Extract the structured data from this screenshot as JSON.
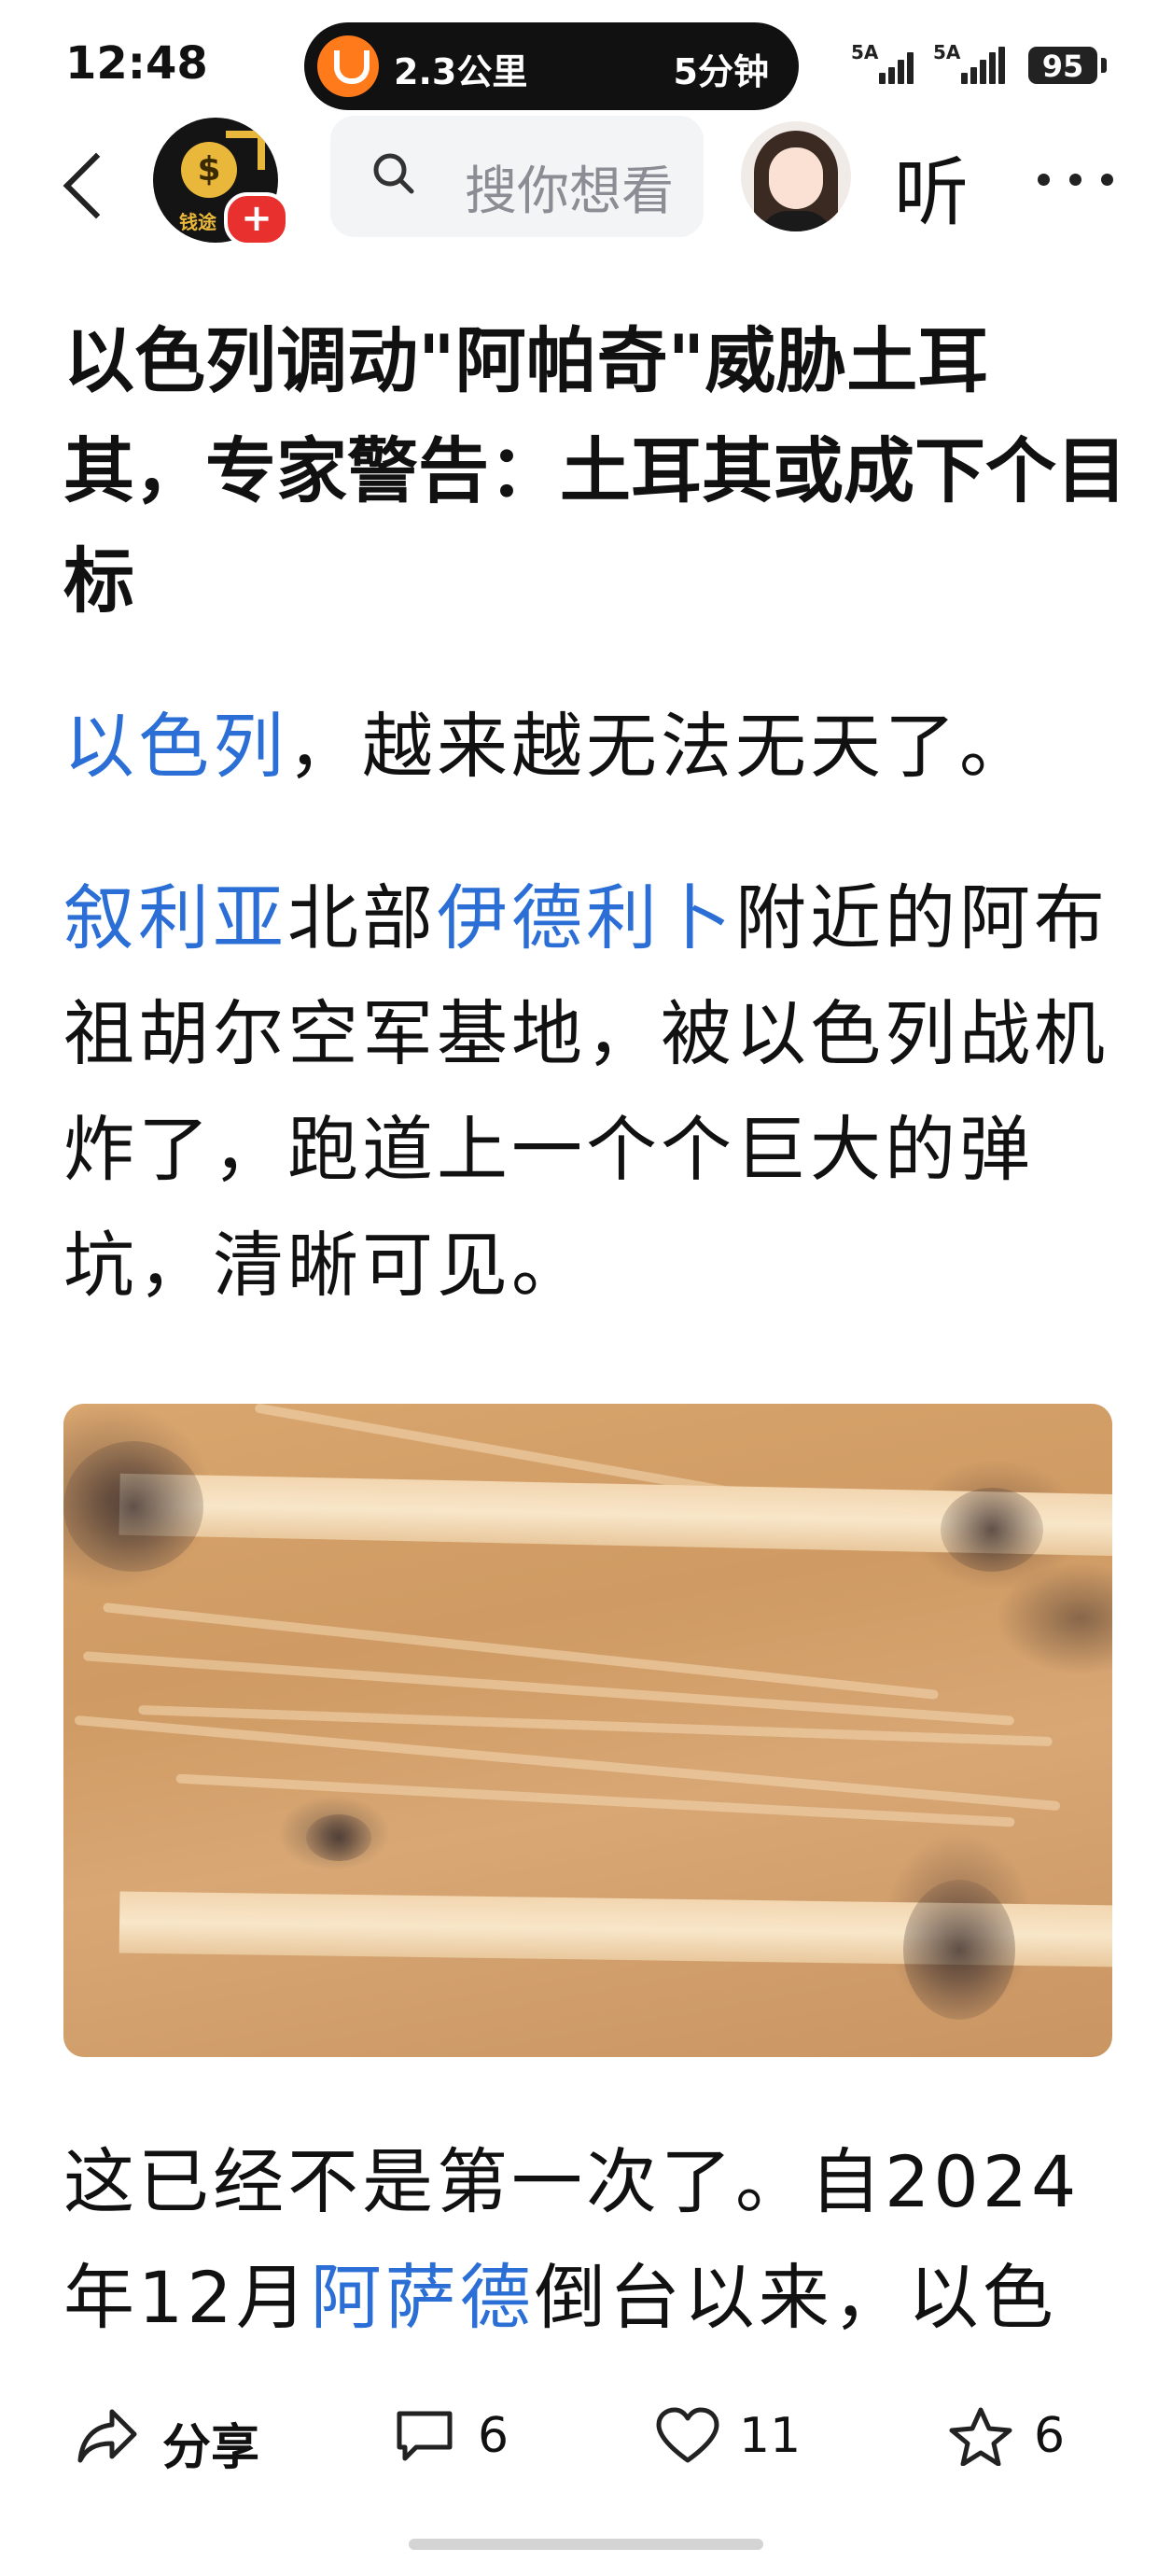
{
  "status_bar": {
    "time": "12:48",
    "ride_distance": "2.3公里",
    "ride_eta": "5分钟",
    "signal_1_label": "5A",
    "signal_2_label": "5A",
    "battery": "95"
  },
  "nav": {
    "author_badge_text": "钱途",
    "follow_label": "+",
    "search_placeholder": "搜你想看",
    "listen_label": "听",
    "more_label": "···"
  },
  "article": {
    "title": "以色列调动\"阿帕奇\"威胁土耳其，专家警告：土耳其或成下个目标",
    "p1": {
      "link1": "以色列",
      "text1": "，越来越无法无天了。"
    },
    "p2": {
      "link1": "叙利亚",
      "text1": "北部",
      "link2": "伊德利卜",
      "text2": "附近的阿布祖胡尔空军基地，被以色列战机炸了，跑道上一个个巨大的弹坑，清晰可见。"
    },
    "p3": {
      "text1": "这已经不是第一次了。自2024年12月",
      "link1": "阿萨德",
      "text2": "倒台以来，以色"
    }
  },
  "actions": {
    "share": "分享",
    "comment_count": "6",
    "like_count": "11",
    "favorite_count": "6"
  },
  "colors": {
    "link": "#2b6fd6",
    "follow_badge": "#e8312f",
    "ride_logo": "#ff7a1a"
  }
}
